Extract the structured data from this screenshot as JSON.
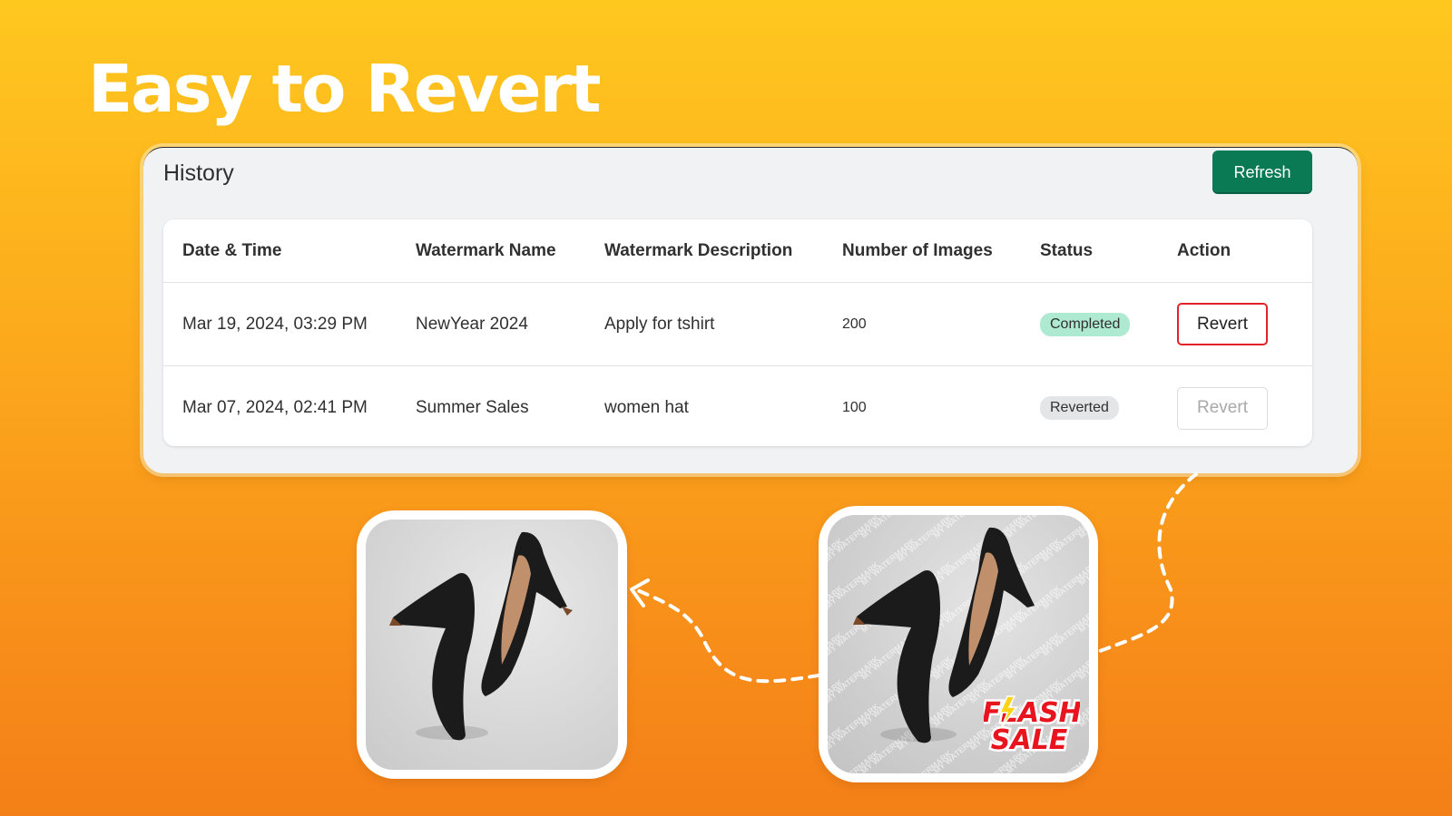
{
  "headline": "Easy to Revert",
  "history": {
    "title": "History",
    "refresh_label": "Refresh",
    "columns": [
      "Date & Time",
      "Watermark Name",
      "Watermark Description",
      "Number of Images",
      "Status",
      "Action"
    ],
    "rows": [
      {
        "datetime": "Mar 19, 2024, 03:29 PM",
        "name": "NewYear 2024",
        "description": "Apply for tshirt",
        "images": "200",
        "status": "Completed",
        "action": "Revert"
      },
      {
        "datetime": "Mar 07, 2024, 02:41 PM",
        "name": "Summer Sales",
        "description": "women hat",
        "images": "100",
        "status": "Reverted",
        "action": "Revert"
      }
    ]
  },
  "images": {
    "watermark_text": "MY WATERMARK",
    "sale_badge_line1": "FLASH",
    "sale_badge_line2": "SALE"
  },
  "colors": {
    "primary_button": "#0a7a55",
    "completed_badge": "#aee9d1",
    "reverted_badge": "#e4e5e7",
    "revert_highlight": "#e3222a"
  }
}
